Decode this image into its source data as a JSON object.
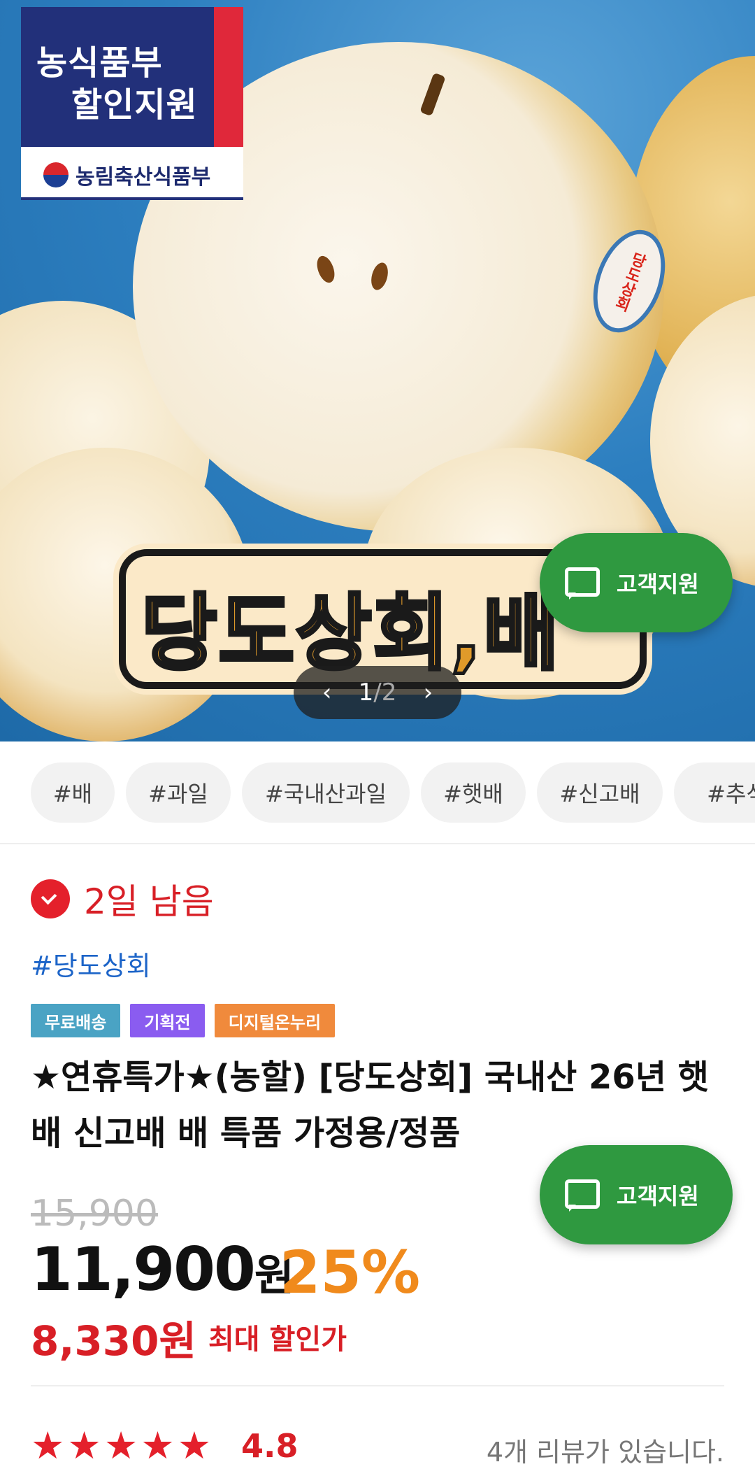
{
  "hero": {
    "badge_line1": "농식품부",
    "badge_line2": "할인지원",
    "ministry": "농림축산식품부",
    "sticker": "당도상회",
    "overlay_title": "당도상회,배",
    "pager_current": "1",
    "pager_separator": "/",
    "pager_total": "2",
    "pager_prev_icon": "chevron-left-icon",
    "pager_next_icon": "chevron-right-icon"
  },
  "support_button": {
    "label": "고객지원",
    "icon": "chat-icon",
    "color": "#2f9940"
  },
  "tags": [
    "#배",
    "#과일",
    "#국내산과일",
    "#햇배",
    "#신고배",
    "#추석"
  ],
  "timer": {
    "text": "2일 남음",
    "icon": "clock-icon"
  },
  "seller": "#당도상회",
  "badges": [
    {
      "label": "무료배송",
      "color": "#4aa3c4"
    },
    {
      "label": "기획전",
      "color": "#8a5cf0"
    },
    {
      "label": "디지털온누리",
      "color": "#f08a3c"
    }
  ],
  "product": {
    "title": "★연휴특가★(농할) [당도상회] 국내산 26년 햇배 신고배 배 특품 가정용/정품",
    "original_price": "15,900",
    "price": "11,900",
    "price_unit": "원",
    "discount": "25%",
    "max_discount_price": "8,330원",
    "max_discount_label": "최대 할인가"
  },
  "rating": {
    "stars": 4.8,
    "value": "4.8",
    "reviews": "4개 리뷰가 있습니다."
  }
}
